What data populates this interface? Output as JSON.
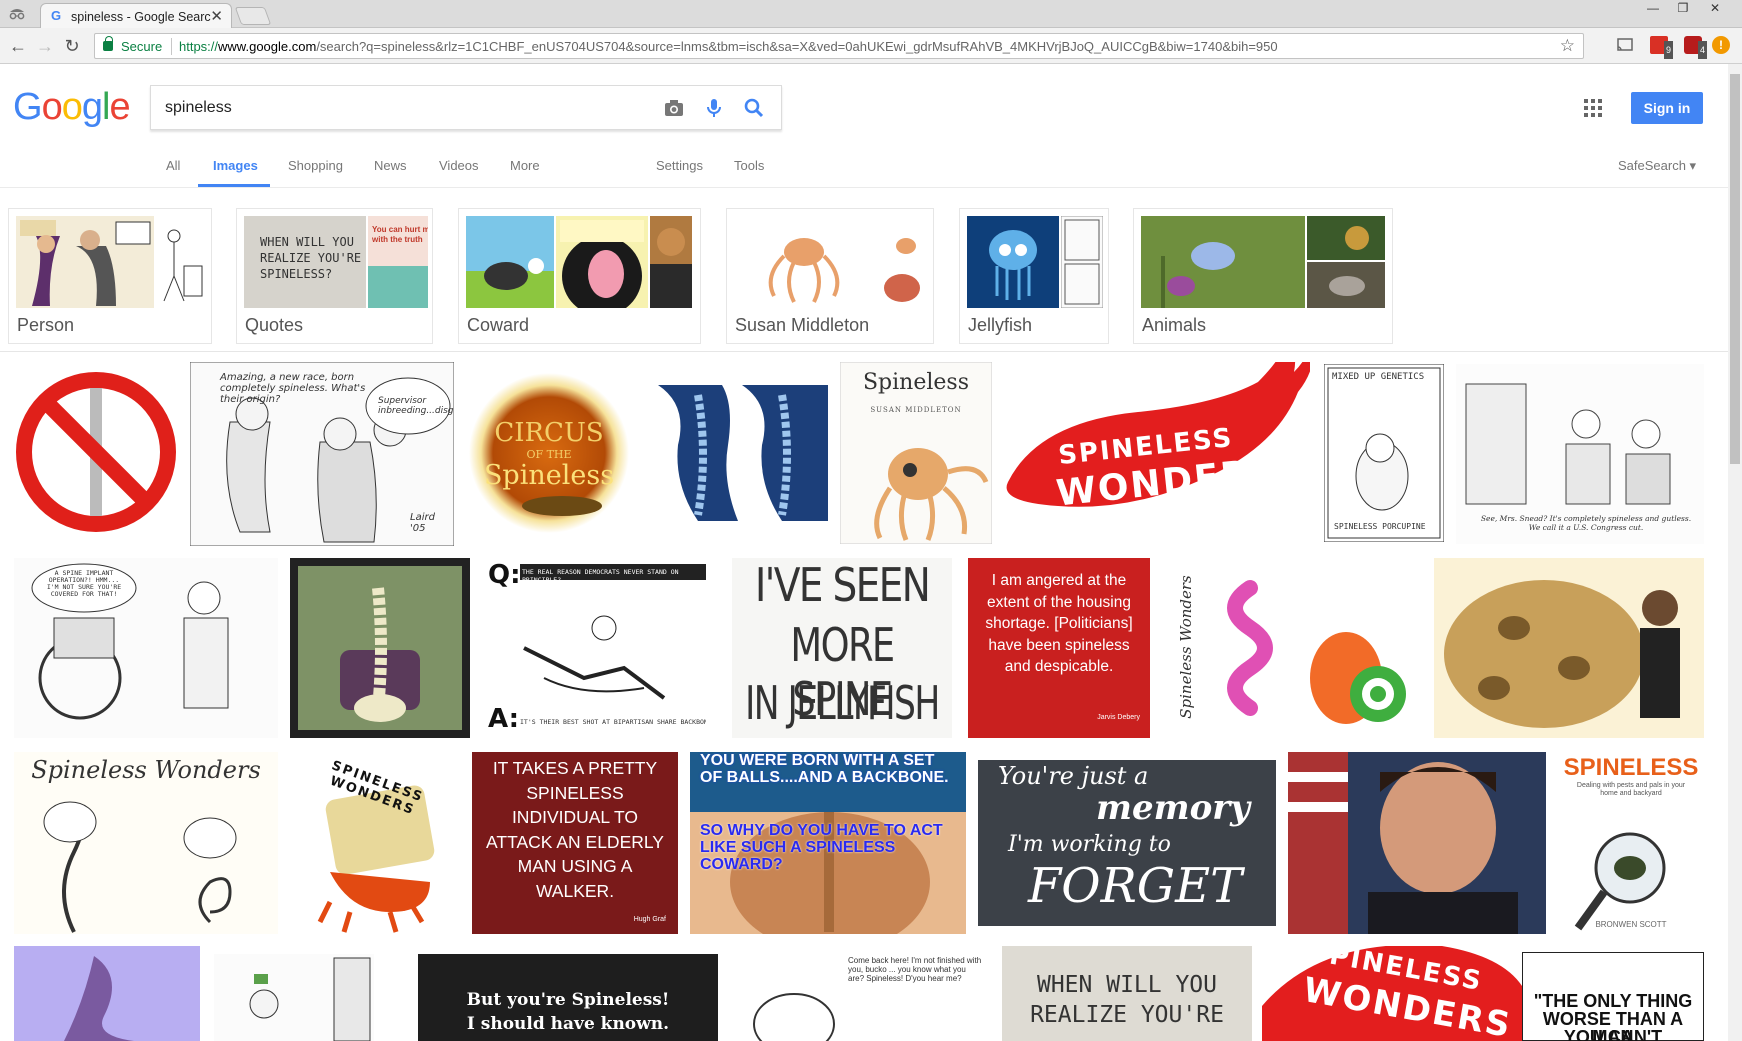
{
  "browser": {
    "tab_title": "spineless - Google Search",
    "tab_favicon": "G",
    "tab_close": "✕",
    "secure_label": "Secure",
    "url_protocol": "https://",
    "url_host": "www.google.com",
    "url_rest": "/search?q=spineless&rlz=1C1CHBF_enUS704US704&source=lnms&tbm=isch&sa=X&ved=0ahUKEwi_gdrMsufRAhVB_4MKHVrjBJoQ_AUICCgB&biw=1740&bih=950",
    "ext_badge_1": "9",
    "ext_badge_2": "4"
  },
  "header": {
    "logo": [
      "G",
      "o",
      "o",
      "g",
      "l",
      "e"
    ],
    "query": "spineless",
    "signin_label": "Sign in",
    "accent": "#4285f4"
  },
  "nav": {
    "all": "All",
    "images": "Images",
    "shopping": "Shopping",
    "news": "News",
    "videos": "Videos",
    "more": "More",
    "settings": "Settings",
    "tools": "Tools",
    "safesearch": "SafeSearch ▾"
  },
  "chips": [
    {
      "label": "Person"
    },
    {
      "label": "Quotes"
    },
    {
      "label": "Coward"
    },
    {
      "label": "Susan Middleton"
    },
    {
      "label": "Jellyfish"
    },
    {
      "label": "Animals"
    }
  ],
  "results": {
    "circus_l1": "CIRCUS",
    "circus_l2": "OF THE",
    "circus_l3": "Spineless",
    "book_title": "Spineless",
    "book_author": "SUSAN MIDDLETON",
    "wonders_l1": "SPINELESS",
    "wonders_l2": "WONDERS",
    "mixed_title": "MIXED UP GENETICS",
    "mixed_caption": "SPINELESS PORCUPINE",
    "snead_caption": "See, Mrs. Snead? It's completely spineless and gutless. We call it a U.S. Congress cut.",
    "cartoon1_text": "Amazing, a new race, born completely spineless. What's their origin?",
    "cartoon1_bubble": "Supervisor inbreeding...disgusting.",
    "cartoon1_sig": "Laird '05",
    "jelly_l1": "I'VE SEEN",
    "jelly_l2": "MORE SPINE",
    "jelly_l3": "IN JELLYFISH",
    "quote_red": "I am angered at the extent of the housing shortage. [Politicians] have been spineless and despicable.",
    "quote_red_author": "Jarvis Debery",
    "wheelchair_bubble": "A SPINE IMPLANT OPERATION?! HMM... I'M NOT SURE YOU'RE COVERED FOR THAT!",
    "q_label": "Q:",
    "a_label": "A:",
    "q_text": "THE REAL REASON DEMOCRATS NEVER STAND ON PRINCIPLE?",
    "a_text": "IT'S THEIR BEST SHOT AT BIPARTISAN SHARE BACKBONE",
    "sw_title": "Spineless Wonders",
    "sw2_title": "SPINELESS WONDERS",
    "elderly_text": "IT TAKES A PRETTY SPINELESS INDIVIDUAL TO ATTACK AN ELDERLY MAN USING A WALKER.",
    "elderly_author": "Hugh Graf",
    "balls_l1": "YOU WERE BORN WITH A SET OF BALLS....AND A BACKBONE.",
    "balls_l2": "SO WHY DO YOU HAVE TO ACT LIKE SUCH A SPINELESS COWARD?",
    "memory_l1": "You're just a",
    "memory_l2": "memory",
    "memory_l3": "I'm working to",
    "memory_l4": "FORGET",
    "fly_title": "SPINELESS",
    "fly_sub": "Dealing with pests and pals in your home and backyard",
    "fly_author": "BRONWEN SCOTT",
    "dark_l1": "But you're Spineless!",
    "dark_l2": "I should have known.",
    "jf_text": "Come back here! I'm not finished with you, bucko ... you know what you are? Spineless! D'you hear me?",
    "when_l1": "WHEN WILL YOU",
    "when_l2": "REALIZE YOU'RE",
    "wonders2_l1": "SPINELESS",
    "wonders2_l2": "WONDERS",
    "only_l1": "\"THE ONLY THING",
    "only_l2": "WORSE THAN A MAN",
    "only_l3": "YOU CAN'T CONTROL"
  }
}
